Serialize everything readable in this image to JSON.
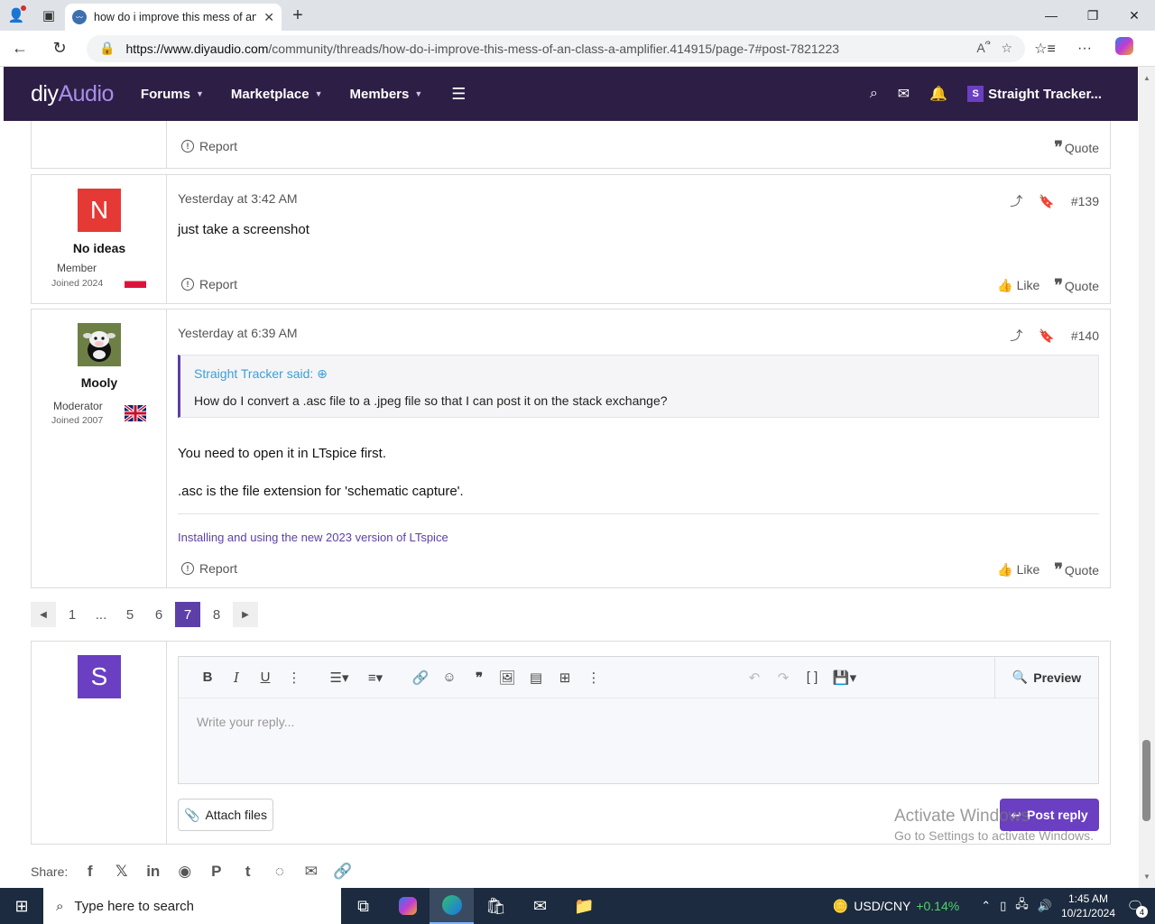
{
  "browser": {
    "tab_title": "how do i improve this mess of an",
    "url_domain": "https://www.diyaudio.com",
    "url_path": "/community/threads/how-do-i-improve-this-mess-of-an-class-a-amplifier.414915/page-7#post-7821223"
  },
  "site": {
    "logo_main": "diy",
    "logo_accent": "Audio",
    "nav": [
      "Forums",
      "Marketplace",
      "Members"
    ],
    "user_initial": "S",
    "user_name": "Straight Tracker..."
  },
  "prev_post": {
    "report_label": "Report",
    "quote_label": "Quote"
  },
  "posts": [
    {
      "avatar_letter": "N",
      "avatar_color": "#e53935",
      "username": "No ideas",
      "user_title": "Member",
      "joined": "Joined 2024",
      "date": "Yesterday at 3:42 AM",
      "number": "#139",
      "body": "just take a screenshot",
      "report_label": "Report",
      "like_label": "Like",
      "quote_label": "Quote"
    },
    {
      "username": "Mooly",
      "user_title": "Moderator",
      "joined": "Joined 2007",
      "date": "Yesterday at 6:39 AM",
      "number": "#140",
      "quote_author": "Straight Tracker said:",
      "quote_text": "How do I convert a .asc file to a .jpeg file so that I can post it on the stack exchange?",
      "body1": "You need to open it in LTspice first.",
      "body2": ".asc is the file extension for 'schematic capture'.",
      "signature": "Installing and using the new 2023 version of LTspice",
      "report_label": "Report",
      "like_label": "Like",
      "quote_label": "Quote"
    }
  ],
  "pager": {
    "pages": [
      "1",
      "...",
      "5",
      "6",
      "7",
      "8"
    ],
    "current": "7"
  },
  "reply": {
    "avatar_letter": "S",
    "avatar_color": "#6a3fc2",
    "placeholder": "Write your reply...",
    "preview_label": "Preview",
    "attach_label": "Attach files",
    "post_label": "Post reply"
  },
  "share": {
    "label": "Share:"
  },
  "watermark": {
    "line1": "Activate Windows",
    "line2": "Go to Settings to activate Windows."
  },
  "taskbar": {
    "search_placeholder": "Type here to search",
    "ticker_name": "USD/CNY",
    "ticker_change": "+0.14%",
    "time": "1:45 AM",
    "date": "10/21/2024",
    "notif_count": "4"
  }
}
